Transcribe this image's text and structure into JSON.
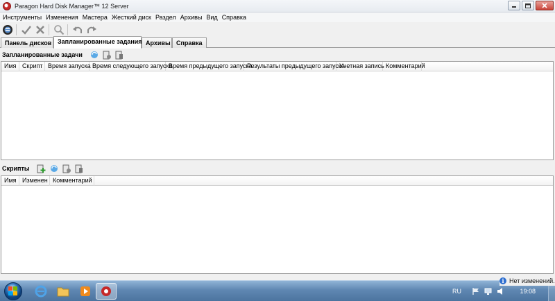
{
  "window": {
    "title": "Paragon Hard Disk Manager™ 12 Server",
    "controls": [
      "minimize",
      "maximize",
      "close"
    ]
  },
  "menu": [
    "Инструменты",
    "Изменения",
    "Мастера",
    "Жесткий диск",
    "Раздел",
    "Архивы",
    "Вид",
    "Справка"
  ],
  "toolbar": {
    "icons": [
      "paragon-logo-icon",
      "apply-check-icon",
      "discard-x-icon",
      "zoom-icon",
      "undo-icon",
      "redo-icon"
    ]
  },
  "tabs": [
    {
      "label": "Панель дисков",
      "active": false
    },
    {
      "label": "Запланированные задания",
      "active": true
    },
    {
      "label": "Архивы",
      "active": false
    },
    {
      "label": "Справка",
      "active": false
    }
  ],
  "scheduled": {
    "title": "Запланированные задачи",
    "columns": [
      "Имя",
      "Скрипт",
      "Время запуска",
      "Время следующего запуска",
      "Время предыдущего запуска",
      "Результаты предыдущего запуска",
      "Учетная запись",
      "Комментарий"
    ]
  },
  "scripts": {
    "title": "Скрипты",
    "columns": [
      "Имя",
      "Изменен",
      "Комментарий"
    ]
  },
  "status": {
    "text": "Нет изменений."
  },
  "taskbar": {
    "lang": "RU",
    "time": "19:08"
  },
  "colors": {
    "active_tab_bg": "#ffffff",
    "taskbar": "#5f87b2",
    "close_button": "#c9443a"
  }
}
